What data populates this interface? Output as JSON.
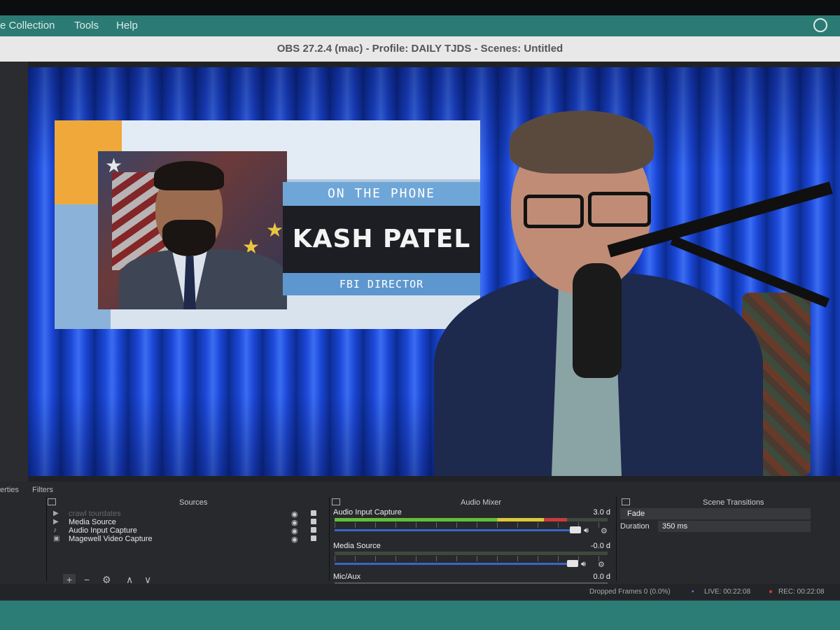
{
  "menu": {
    "items": [
      "e Collection",
      "Tools",
      "Help"
    ]
  },
  "window": {
    "title": "OBS 27.2.4 (mac) - Profile: DAILY TJDS - Scenes: Untitled"
  },
  "preview": {
    "graphic": {
      "kicker": "ON THE PHONE",
      "name": "KASH PATEL",
      "role": "FBI DIRECTOR"
    }
  },
  "dock": {
    "left_tabs": [
      "erties",
      "Filters"
    ],
    "sources": {
      "title": "Sources",
      "items": [
        {
          "label": "crawl tourdates",
          "icon": "play-icon",
          "faded": true
        },
        {
          "label": "Media Source",
          "icon": "play-icon",
          "faded": false
        },
        {
          "label": "Audio Input Capture",
          "icon": "microphone-icon",
          "faded": false
        },
        {
          "label": "Magewell Video Capture",
          "icon": "camera-icon",
          "faded": false
        }
      ],
      "toolbar": [
        "+",
        "−",
        "⚙",
        "∧",
        "∨"
      ]
    },
    "audio_mixer": {
      "title": "Audio Mixer",
      "channels": [
        {
          "name": "Audio Input Capture",
          "db": "3.0 d",
          "level": 0.85
        },
        {
          "name": "Media Source",
          "db": "-0.0 d",
          "level": 0.0
        },
        {
          "name": "Mic/Aux",
          "db": "0.0 d",
          "level": 0.0
        }
      ]
    },
    "scene_transitions": {
      "title": "Scene Transitions",
      "transition": "Fade",
      "duration_label": "Duration",
      "duration_value": "350 ms"
    }
  },
  "status": {
    "dropped_frames": "Dropped Frames 0 (0.0%)",
    "live": "LIVE: 00:22:08",
    "rec": "REC: 00:22:08"
  },
  "colors": {
    "menubar": "#2c7a74",
    "fader": "#3a66c8",
    "meter_green": "#5fbf3a",
    "meter_yellow": "#d8c93a",
    "meter_red": "#c83a3a"
  }
}
